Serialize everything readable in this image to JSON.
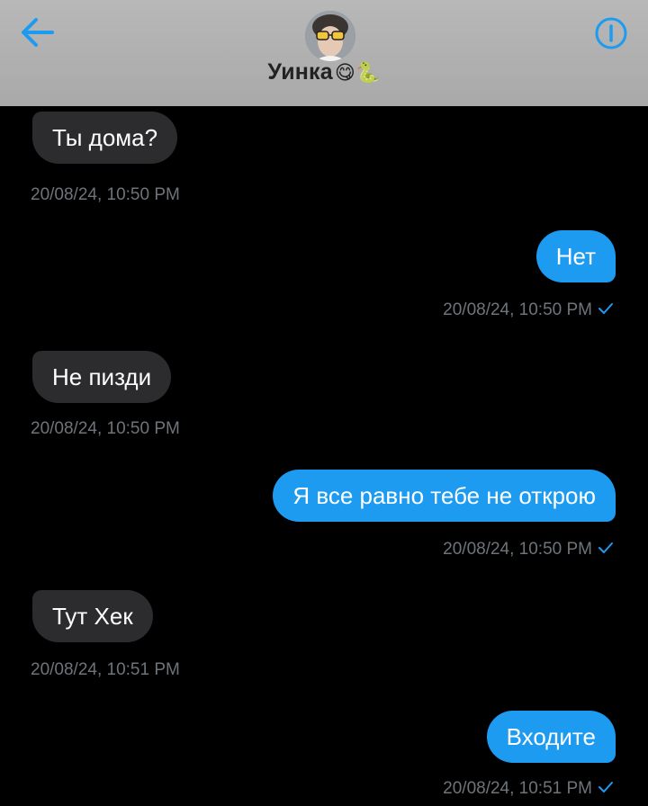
{
  "header": {
    "contact_name": "Уинка",
    "contact_emoji": "😋🐍",
    "back_icon": "arrow-left-icon",
    "info_icon": "info-icon",
    "accent_color": "#1d9bf0"
  },
  "messages": [
    {
      "direction": "in",
      "text": "Ты дома?",
      "time": "20/08/24, 10:50 PM"
    },
    {
      "direction": "out",
      "text": "Нет",
      "time": "20/08/24, 10:50 PM",
      "read": true
    },
    {
      "direction": "in",
      "text": "Не пизди",
      "time": "20/08/24, 10:50 PM"
    },
    {
      "direction": "out",
      "text": "Я все равно тебе не открою",
      "time": "20/08/24, 10:50 PM",
      "read": true
    },
    {
      "direction": "in",
      "text": "Тут Хек",
      "time": "20/08/24, 10:51 PM"
    },
    {
      "direction": "out",
      "text": "Входите",
      "time": "20/08/24, 10:51 PM",
      "read": true
    }
  ]
}
